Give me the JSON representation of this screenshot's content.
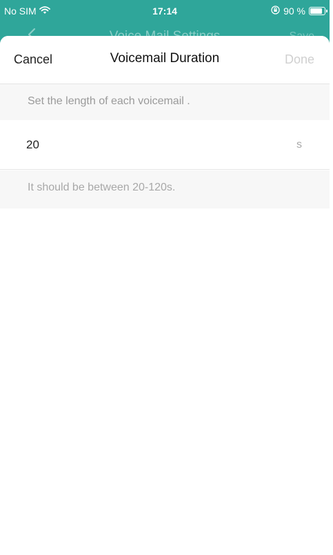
{
  "status_bar": {
    "carrier": "No SIM",
    "time": "17:14",
    "battery_text": "90 %",
    "battery_level": 0.9,
    "wifi_icon": "wifi-icon",
    "lock_icon": "orientation-lock-icon"
  },
  "parent_nav": {
    "back_icon": "chevron-left-icon",
    "title": "Voice Mail Settings",
    "save_label": "Save"
  },
  "sheet": {
    "cancel_label": "Cancel",
    "title": "Voicemail Duration",
    "done_label": "Done",
    "description": "Set the length of each voicemail .",
    "duration_value": "20",
    "unit": "s",
    "hint": "It should be between 20-120s."
  },
  "colors": {
    "accent": "#2fa69a",
    "done_disabled": "#d0d0d0",
    "muted_text": "#a8a8a8",
    "section_bg": "#f7f7f7"
  }
}
